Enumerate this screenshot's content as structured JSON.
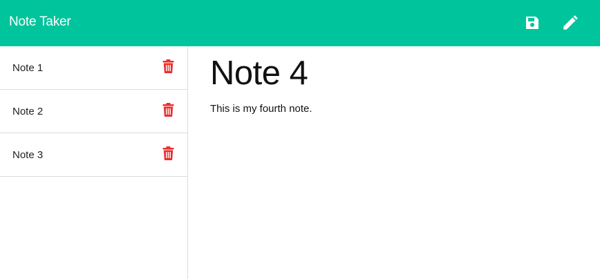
{
  "app": {
    "title": "Note Taker",
    "accent_color": "#00c49c",
    "delete_color": "#ef2d2d"
  },
  "toolbar": {
    "save_icon": "save-icon",
    "edit_icon": "pencil-icon"
  },
  "sidebar": {
    "notes": [
      {
        "title": "Note 1",
        "delete_icon": "trash-icon"
      },
      {
        "title": "Note 2",
        "delete_icon": "trash-icon"
      },
      {
        "title": "Note 3",
        "delete_icon": "trash-icon"
      }
    ]
  },
  "main": {
    "note_title": "Note 4",
    "note_text": "This is my fourth note."
  }
}
